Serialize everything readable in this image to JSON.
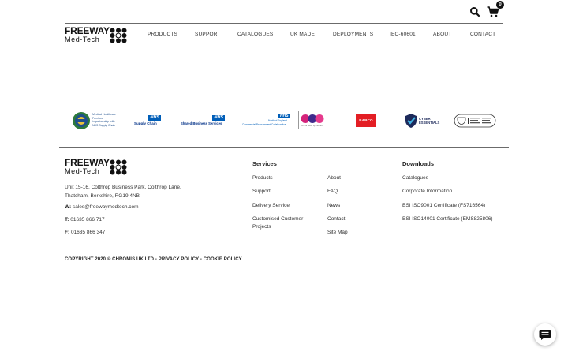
{
  "header": {
    "cart_count": "0",
    "logo": {
      "line1": "FREEWAY",
      "line2": "Med-Tech"
    },
    "nav": [
      "PRODUCTS",
      "SUPPORT",
      "CATALOGUES",
      "UK MADE",
      "DEPLOYMENTS",
      "IEC-60601",
      "ABOUT",
      "CONTACT"
    ]
  },
  "partners": {
    "medical": {
      "line1": "Medical Healthcare",
      "line2": "Furniture",
      "line3": "in partnership with",
      "line4": "NHS Supply Chain"
    },
    "nhs_supply": {
      "badge": "NHS",
      "text": "Supply Chain"
    },
    "nhs_shared": {
      "badge": "NHS",
      "text": "Shared Business Services"
    },
    "nhs_north": {
      "badge": "NHS",
      "line1": "North of England",
      "line2": "Commercial Procurement Collaborative",
      "tagline": "For the NHS, by the NHS"
    },
    "barco": {
      "text": "BARCO"
    },
    "cyber": {
      "line1": "CYBER",
      "line2": "ESSENTIALS"
    }
  },
  "footer": {
    "logo": {
      "line1": "FREEWAY",
      "line2": "Med-Tech"
    },
    "address": "Unit 15-16, Colthrop Business Park, Colthrop Lane, Thatcham, Berkshire, RG19 4NB",
    "email_label": "W:",
    "email": "sales@freewaymedtech.com",
    "phone_label": "T:",
    "phone": "01635 866 717",
    "fax_label": "F:",
    "fax": "01635 866 347",
    "services": {
      "title": "Services",
      "col1": [
        "Products",
        "Support",
        "Delivery Service",
        "Customised Customer Projects"
      ],
      "col2": [
        "About",
        "FAQ",
        "News",
        "Contact",
        "Site Map"
      ]
    },
    "downloads": {
      "title": "Downloads",
      "items": [
        "Catalogues",
        "Corporate Information",
        "BSI ISO9001 Certificate (FS716564)",
        "BSI ISO14001 Certificate (EMS825806)"
      ]
    },
    "copyright": "COPYRIGHT 2020 © CHROMIS UK LTD - PRIVACY POLICY - COOKIE POLICY"
  },
  "colors": {
    "nhs_blue": "#005eb8",
    "barco_red": "#e31e24",
    "text_dark": "#222222",
    "divider": "#6b6b6b"
  },
  "icons": [
    "search-icon",
    "cart-icon",
    "chat-icon"
  ]
}
